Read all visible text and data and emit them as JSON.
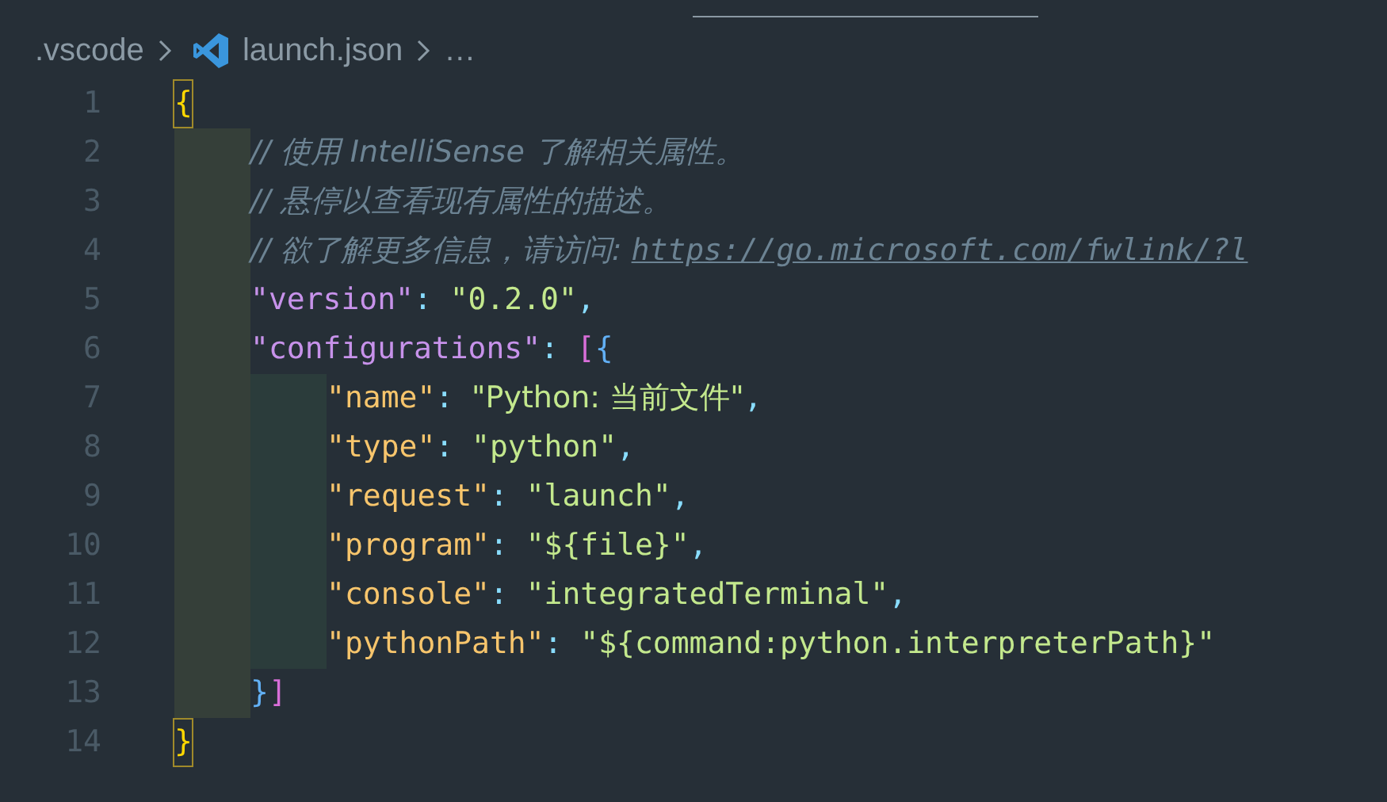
{
  "breadcrumb": [
    {
      "kind": "folder",
      "label": ".vscode"
    },
    {
      "kind": "file",
      "label": "launch.json"
    },
    {
      "kind": "more",
      "label": "…"
    }
  ],
  "lines": [
    {
      "number": "1",
      "tokens": [
        {
          "kind": "brace",
          "text": "{",
          "matched": true
        }
      ],
      "children": [
        {
          "number": "2",
          "tokens": [
            {
              "kind": "comment",
              "text": "// 使用 IntelliSense 了解相关属性。"
            }
          ]
        },
        {
          "number": "3",
          "tokens": [
            {
              "kind": "comment",
              "text": "// 悬停以查看现有属性的描述。"
            }
          ]
        },
        {
          "number": "4",
          "tokens": [
            {
              "kind": "comment",
              "text": "// 欲了解更多信息，请访问: "
            },
            {
              "kind": "link",
              "text": "https://go.microsoft.com/fwlink/?l"
            }
          ]
        },
        {
          "number": "5",
          "tokens": [
            {
              "kind": "key",
              "text": "\"version\""
            },
            {
              "kind": "punct",
              "text": ": "
            },
            {
              "kind": "string",
              "text": "\"0.2.0\""
            },
            {
              "kind": "punct",
              "text": ","
            }
          ]
        },
        {
          "number": "6",
          "tokens": [
            {
              "kind": "key",
              "text": "\"configurations\""
            },
            {
              "kind": "punct",
              "text": ": "
            },
            {
              "kind": "bracket",
              "text": "["
            },
            {
              "kind": "brace2",
              "text": "{"
            }
          ],
          "children": [
            {
              "number": "7",
              "tokens": [
                {
                  "kind": "key2",
                  "text": "\"name\""
                },
                {
                  "kind": "punct",
                  "text": ": "
                },
                {
                  "kind": "string",
                  "text": "\"Python: 当前文件\""
                },
                {
                  "kind": "punct",
                  "text": ","
                }
              ]
            },
            {
              "number": "8",
              "tokens": [
                {
                  "kind": "key2",
                  "text": "\"type\""
                },
                {
                  "kind": "punct",
                  "text": ": "
                },
                {
                  "kind": "string",
                  "text": "\"python\""
                },
                {
                  "kind": "punct",
                  "text": ","
                }
              ]
            },
            {
              "number": "9",
              "tokens": [
                {
                  "kind": "key2",
                  "text": "\"request\""
                },
                {
                  "kind": "punct",
                  "text": ": "
                },
                {
                  "kind": "string",
                  "text": "\"launch\""
                },
                {
                  "kind": "punct",
                  "text": ","
                }
              ]
            },
            {
              "number": "10",
              "tokens": [
                {
                  "kind": "key2",
                  "text": "\"program\""
                },
                {
                  "kind": "punct",
                  "text": ": "
                },
                {
                  "kind": "string",
                  "text": "\"${file}\""
                },
                {
                  "kind": "punct",
                  "text": ","
                }
              ]
            },
            {
              "number": "11",
              "tokens": [
                {
                  "kind": "key2",
                  "text": "\"console\""
                },
                {
                  "kind": "punct",
                  "text": ": "
                },
                {
                  "kind": "string",
                  "text": "\"integratedTerminal\""
                },
                {
                  "kind": "punct",
                  "text": ","
                }
              ]
            },
            {
              "number": "12",
              "tokens": [
                {
                  "kind": "key2",
                  "text": "\"pythonPath\""
                },
                {
                  "kind": "punct",
                  "text": ": "
                },
                {
                  "kind": "string",
                  "text": "\"${command:python.interpreterPath}\""
                }
              ]
            }
          ]
        },
        {
          "number": "13",
          "tokens": [
            {
              "kind": "brace2",
              "text": "}"
            },
            {
              "kind": "bracket",
              "text": "]"
            }
          ]
        }
      ]
    },
    {
      "number": "14",
      "tokens": [
        {
          "kind": "brace",
          "text": "}",
          "matched": true
        }
      ]
    }
  ]
}
